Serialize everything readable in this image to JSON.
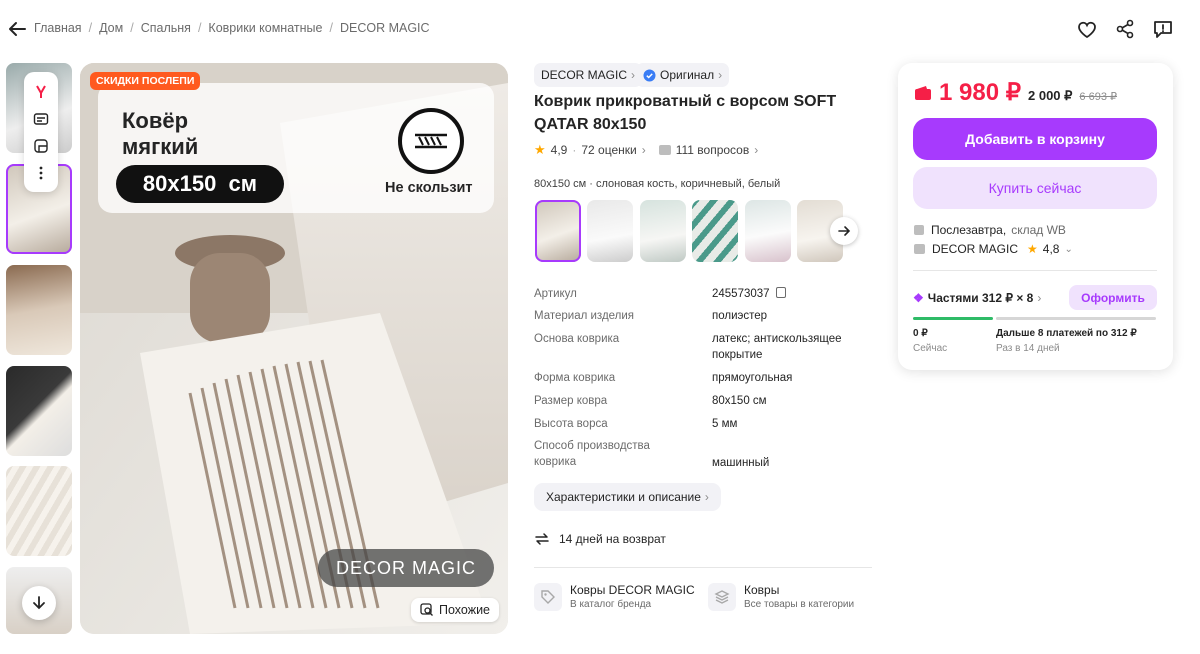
{
  "breadcrumbs": [
    "Главная",
    "Дом",
    "Спальня",
    "Коврики комнатные",
    "DECOR MAGIC"
  ],
  "gallery": {
    "badge": "СКИДКИ ПОСЛЕПИ",
    "overlay_title_1": "Ковёр",
    "overlay_title_2": "мягкий",
    "overlay_size": "80x150  см",
    "overlay_nonslip": "Не скользит",
    "watermark": "DECOR MAGIC",
    "similar_label": "Похожие"
  },
  "product": {
    "brand": "DECOR MAGIC",
    "original_label": "Оригинал",
    "title": "Коврик прикроватный с ворсом SOFT QATAR 80x150",
    "rating": "4,9",
    "reviews": "72 оценки",
    "questions": "111 вопросов",
    "variant_subtitle": "80x150 см · слоновая кость, коричневый, белый"
  },
  "specs": [
    {
      "k": "Артикул",
      "v": "245573037"
    },
    {
      "k": "Материал изделия",
      "v": "полиэстер"
    },
    {
      "k": "Основа коврика",
      "v": "латекс; антискользящее покрытие"
    },
    {
      "k": "Форма коврика",
      "v": "прямоугольная"
    },
    {
      "k": "Размер ковра",
      "v": "80x150 см"
    },
    {
      "k": "Высота ворса",
      "v": "5 мм"
    },
    {
      "k": "Способ производства коврика",
      "v": "машинный"
    }
  ],
  "characteristics_btn": "Характеристики и описание",
  "returns": "14 дней на возврат",
  "links": [
    {
      "t1": "Ковры DECOR MAGIC",
      "t2": "В каталог бренда"
    },
    {
      "t1": "Ковры",
      "t2": "Все товары в категории"
    }
  ],
  "buy": {
    "price": "1 980 ₽",
    "price_old": "2 000 ₽",
    "price_strike": "6 693 ₽",
    "add_cart": "Добавить в корзину",
    "buy_now": "Купить сейчас",
    "delivery": "Послезавтра,",
    "delivery_wh": "склад WB",
    "seller": "DECOR MAGIC",
    "seller_rating": "4,8",
    "installments": "Частями 312 ₽ × 8",
    "installments_btn": "Оформить",
    "now_amount": "0 ₽",
    "now_label": "Сейчас",
    "later_amount": "Дальше 8 платежей по 312 ₽",
    "later_label": "Раз в 14 дней"
  },
  "colors": {
    "accent": "#a73afd",
    "price": "#f51f47",
    "badge": "#ff5a1f",
    "green": "#2fbb67"
  }
}
